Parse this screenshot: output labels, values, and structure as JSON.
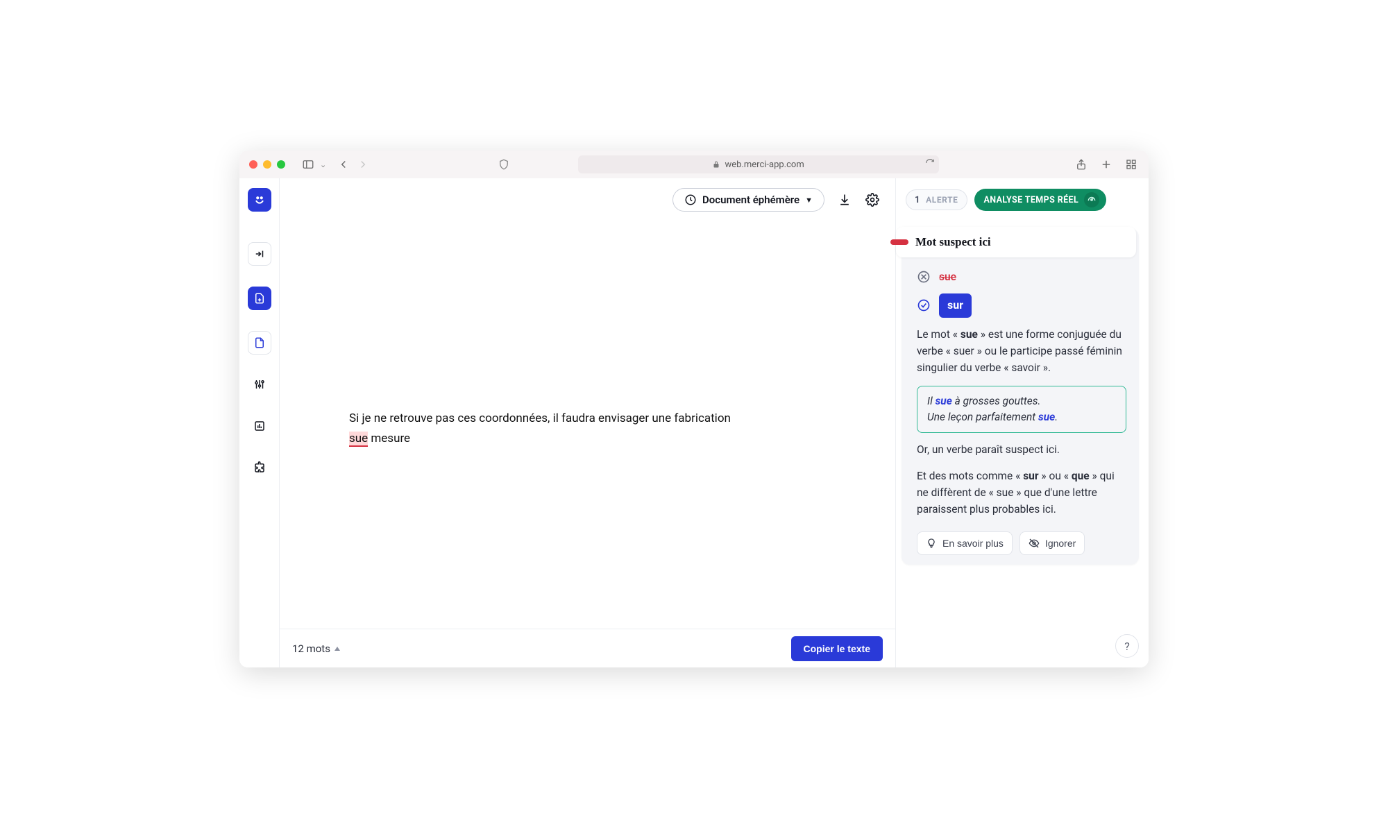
{
  "browser": {
    "url": "web.merci-app.com"
  },
  "header": {
    "doc_type_label": "Document éphémère"
  },
  "editor": {
    "body_part1": "Si je ne retrouve pas ces coordonnées, il faudra envisager une fabrication ",
    "error_word": "sue",
    "body_part2": " mesure"
  },
  "footer": {
    "word_count": "12 mots",
    "copy_label": "Copier le texte"
  },
  "panel": {
    "alert_count": "1",
    "alert_label": "ALERTE",
    "realtime_label": "ANALYSE TEMPS RÉEL",
    "card": {
      "title": "Mot suspect ici",
      "wrong": "sue",
      "suggestion": "sur",
      "explanation_p1a": "Le mot « ",
      "explanation_p1_bold": "sue",
      "explanation_p1b": " » est une forme conjuguée du verbe « suer » ou le participe passé féminin singulier du verbe « savoir ».",
      "example1_a": "Il ",
      "example1_hl": "sue",
      "example1_b": " à grosses gouttes.",
      "example2_a": "Une leçon parfaitement ",
      "example2_hl": "sue",
      "example2_b": ".",
      "explanation_p2": "Or, un verbe paraît suspect ici.",
      "explanation_p3a": "Et des mots comme « ",
      "explanation_p3_bold1": "sur",
      "explanation_p3b": " » ou « ",
      "explanation_p3_bold2": "que",
      "explanation_p3c": " » qui ne diffèrent de « sue » que d'une lettre paraissent plus probables ici.",
      "learn_more": "En savoir plus",
      "ignore": "Ignorer"
    }
  },
  "help": "?"
}
